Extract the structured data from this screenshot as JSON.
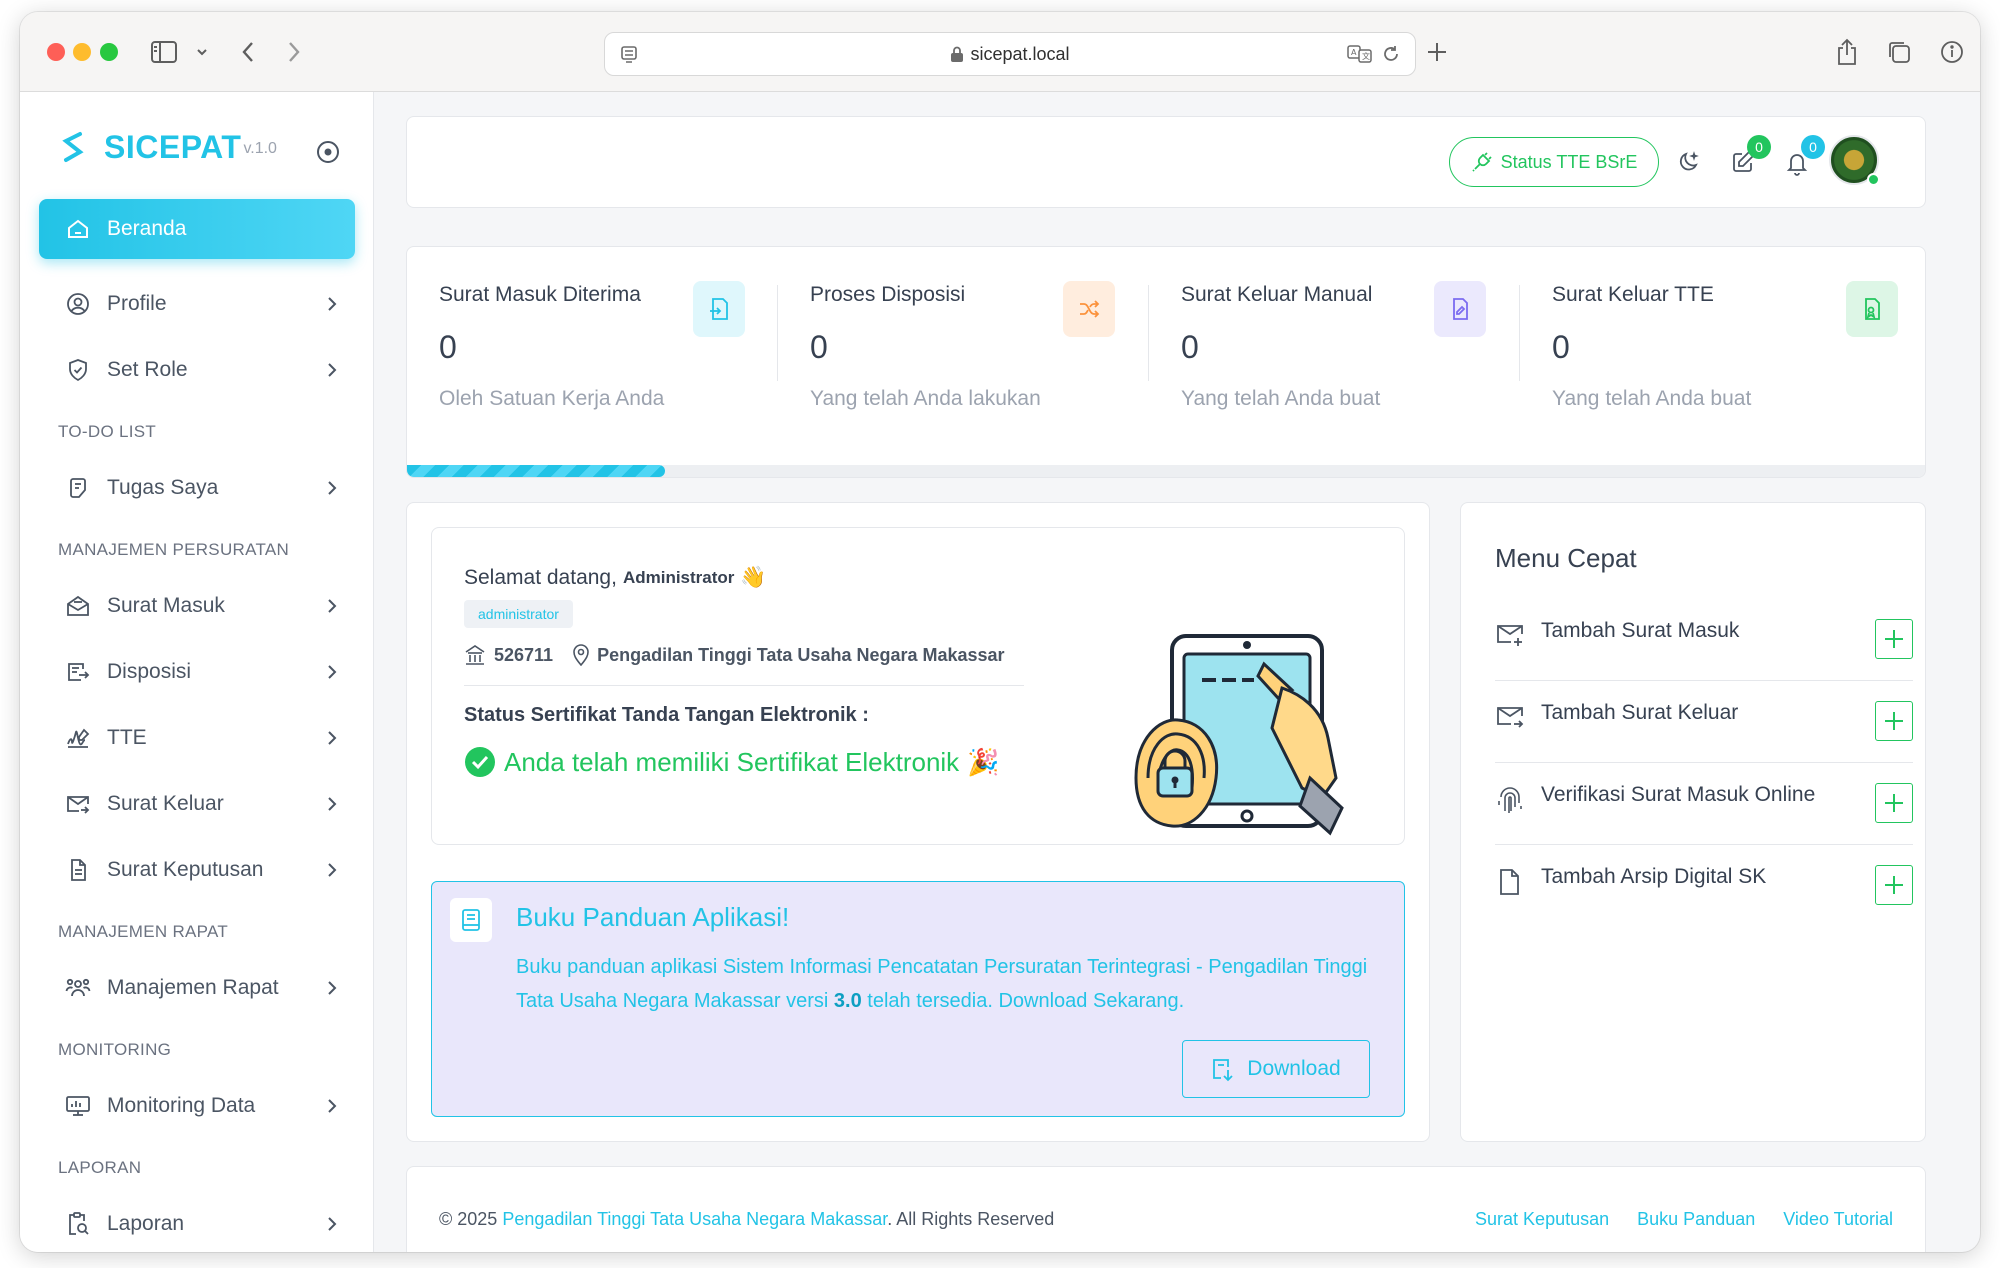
{
  "browser": {
    "url": "sicepat.local"
  },
  "app": {
    "name": "SICEPAT",
    "version": "v.1.0",
    "accent": "#22c3e6",
    "success": "#22c55e"
  },
  "sidebar": {
    "active": {
      "label": "Beranda",
      "icon": "home-icon"
    },
    "items": [
      {
        "label": "Profile",
        "icon": "user-circle-icon"
      },
      {
        "label": "Set Role",
        "icon": "shield-check-icon"
      }
    ],
    "sections": [
      {
        "title": "TO-DO LIST",
        "items": [
          {
            "label": "Tugas Saya",
            "icon": "clipboard-list-icon"
          }
        ]
      },
      {
        "title": "MANAJEMEN PERSURATAN",
        "items": [
          {
            "label": "Surat Masuk",
            "icon": "mail-open-icon"
          },
          {
            "label": "Disposisi",
            "icon": "share-list-icon"
          },
          {
            "label": "TTE",
            "icon": "signature-icon"
          },
          {
            "label": "Surat Keluar",
            "icon": "mail-send-icon"
          },
          {
            "label": "Surat Keputusan",
            "icon": "file-text-icon"
          }
        ]
      },
      {
        "title": "MANAJEMEN RAPAT",
        "items": [
          {
            "label": "Manajemen Rapat",
            "icon": "users-icon"
          }
        ]
      },
      {
        "title": "MONITORING",
        "items": [
          {
            "label": "Monitoring Data",
            "icon": "monitor-icon"
          }
        ]
      },
      {
        "title": "LAPORAN",
        "items": [
          {
            "label": "Laporan",
            "icon": "report-search-icon"
          }
        ]
      }
    ]
  },
  "topbar": {
    "tte_status_label": "Status TTE BSrE",
    "edit_badge": "0",
    "notification_badge": "0"
  },
  "stats": [
    {
      "title": "Surat Masuk Diterima",
      "value": "0",
      "subtitle": "Oleh Satuan Kerja Anda",
      "icon": "login-icon",
      "color": "#22c3e6",
      "bg": "#dff7fc"
    },
    {
      "title": "Proses Disposisi",
      "value": "0",
      "subtitle": "Yang telah Anda lakukan",
      "icon": "shuffle-icon",
      "color": "#fb923c",
      "bg": "#ffedde"
    },
    {
      "title": "Surat Keluar Manual",
      "value": "0",
      "subtitle": "Yang telah Anda buat",
      "icon": "file-edit-icon",
      "color": "#7c6cf0",
      "bg": "#ebe9fd"
    },
    {
      "title": "Surat Keluar TTE",
      "value": "0",
      "subtitle": "Yang telah Anda buat",
      "icon": "file-signature-icon",
      "color": "#22c55e",
      "bg": "#ddf6e6"
    }
  ],
  "progress": {
    "fraction": 0.17
  },
  "welcome": {
    "greeting": "Selamat datang,",
    "name": "Administrator",
    "wave": "👋",
    "role": "administrator",
    "code": "526711",
    "office": "Pengadilan Tinggi Tata Usaha Negara Makassar",
    "cert_label": "Status Sertifikat Tanda Tangan Elektronik :",
    "cert_status": "Anda telah memiliki Sertifikat Elektronik",
    "party": "🎉"
  },
  "guide": {
    "title": "Buku Panduan Aplikasi!",
    "text_before": "Buku panduan aplikasi Sistem Informasi Pencatatan Persuratan Terintegrasi - Pengadilan Tinggi Tata Usaha Negara Makassar versi ",
    "version": "3.0",
    "text_after": " telah tersedia. Download Sekarang.",
    "download_label": "Download"
  },
  "quick_menu": {
    "title": "Menu Cepat",
    "items": [
      {
        "label": "Tambah Surat Masuk",
        "icon": "mail-plus-icon"
      },
      {
        "label": "Tambah Surat Keluar",
        "icon": "mail-arrow-icon"
      },
      {
        "label": "Verifikasi Surat Masuk Online",
        "icon": "fingerprint-icon"
      },
      {
        "label": "Tambah Arsip Digital SK",
        "icon": "file-icon"
      }
    ]
  },
  "footer": {
    "copyright_prefix": "© 2025 ",
    "org": "Pengadilan Tinggi Tata Usaha Negara Makassar",
    "copyright_suffix": ". All Rights Reserved",
    "links": [
      "Surat Keputusan",
      "Buku Panduan",
      "Video Tutorial"
    ]
  }
}
